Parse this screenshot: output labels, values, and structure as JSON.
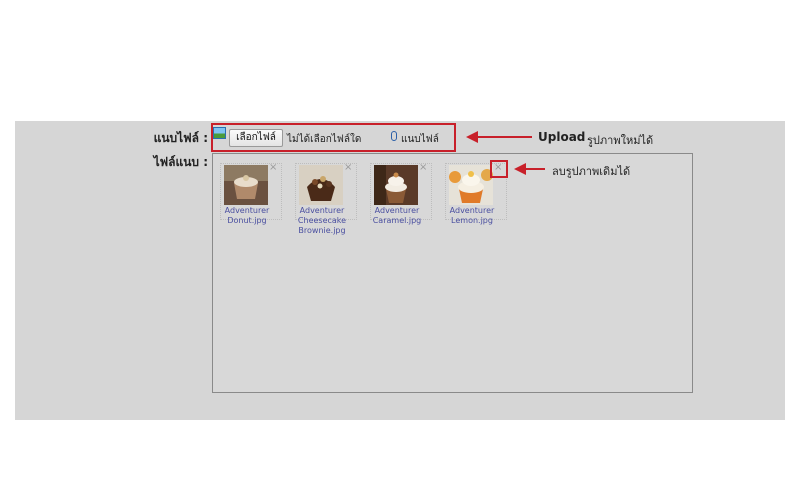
{
  "form": {
    "attach_file_label": "แนบไฟล์ :",
    "attached_files_label": "ไฟล์แนบ :"
  },
  "upload": {
    "choose_button": "เลือกไฟล์",
    "no_file_text": "ไม่ได้เลือกไฟล์ใด",
    "attach_link": "แนบไฟล์"
  },
  "annotations": {
    "upload_bold": "Upload",
    "upload_text": "รูปภาพใหม่ได้",
    "delete_text": "ลบรูปภาพเดิมได้",
    "accent_color": "#c8202a"
  },
  "attachments": [
    {
      "line1": "Adventurer",
      "line2": "Donut.jpg",
      "line3": "",
      "close": "×"
    },
    {
      "line1": "Adventurer",
      "line2": "Cheesecake",
      "line3": "Brownie.jpg",
      "close": "×"
    },
    {
      "line1": "Adventurer",
      "line2": "Caramel.jpg",
      "line3": "",
      "close": "×"
    },
    {
      "line1": "Adventurer",
      "line2": "Lemon.jpg",
      "line3": "",
      "close": "×"
    }
  ]
}
